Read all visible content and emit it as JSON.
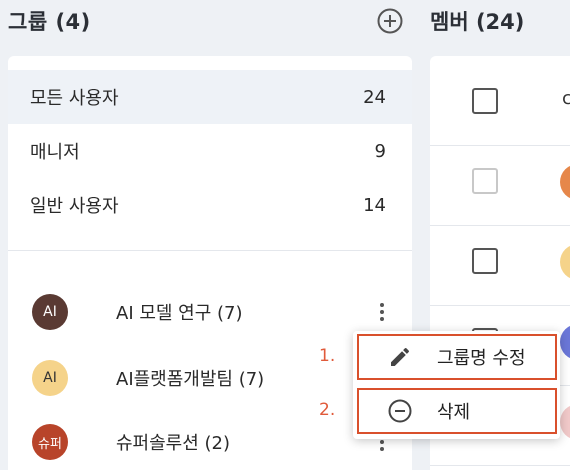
{
  "header": {
    "groups_title": "그룹 (4)",
    "add_icon": "plus-circle-icon",
    "members_title": "멤버 (24)"
  },
  "filters": [
    {
      "label": "모든 사용자",
      "count": "24",
      "selected": true
    },
    {
      "label": "매니저",
      "count": "9",
      "selected": false
    },
    {
      "label": "일반 사용자",
      "count": "14",
      "selected": false
    }
  ],
  "groups": [
    {
      "avatar": "AI",
      "avatar_color": "#5a3a33",
      "avatar_text_color": "#ffffff",
      "name": "AI 모델 연구 (7)",
      "more_icon": "kebab-menu-icon"
    },
    {
      "avatar": "AI",
      "avatar_color": "#f5d38a",
      "avatar_text_color": "#333333",
      "name": "AI플랫폼개발팀 (7)",
      "more_icon": "kebab-menu-icon"
    },
    {
      "avatar": "슈퍼",
      "avatar_color": "#b8442a",
      "avatar_text_color": "#ffffff",
      "name": "슈퍼솔루션 (2)",
      "more_icon": "kebab-menu-icon"
    }
  ],
  "members": {
    "row1_text": "c",
    "row2_avatar_color": "#e6874a",
    "row3_avatar_color": "#f5d38a"
  },
  "context_menu": {
    "items": [
      {
        "step": "1.",
        "label": "그룹명 수정",
        "icon": "pencil-icon"
      },
      {
        "step": "2.",
        "label": "삭제",
        "icon": "minus-circle-icon"
      }
    ]
  },
  "colors": {
    "highlight_border": "#d9502c",
    "step_number": "#e05a3a",
    "selected_bg": "#eef2f7"
  }
}
